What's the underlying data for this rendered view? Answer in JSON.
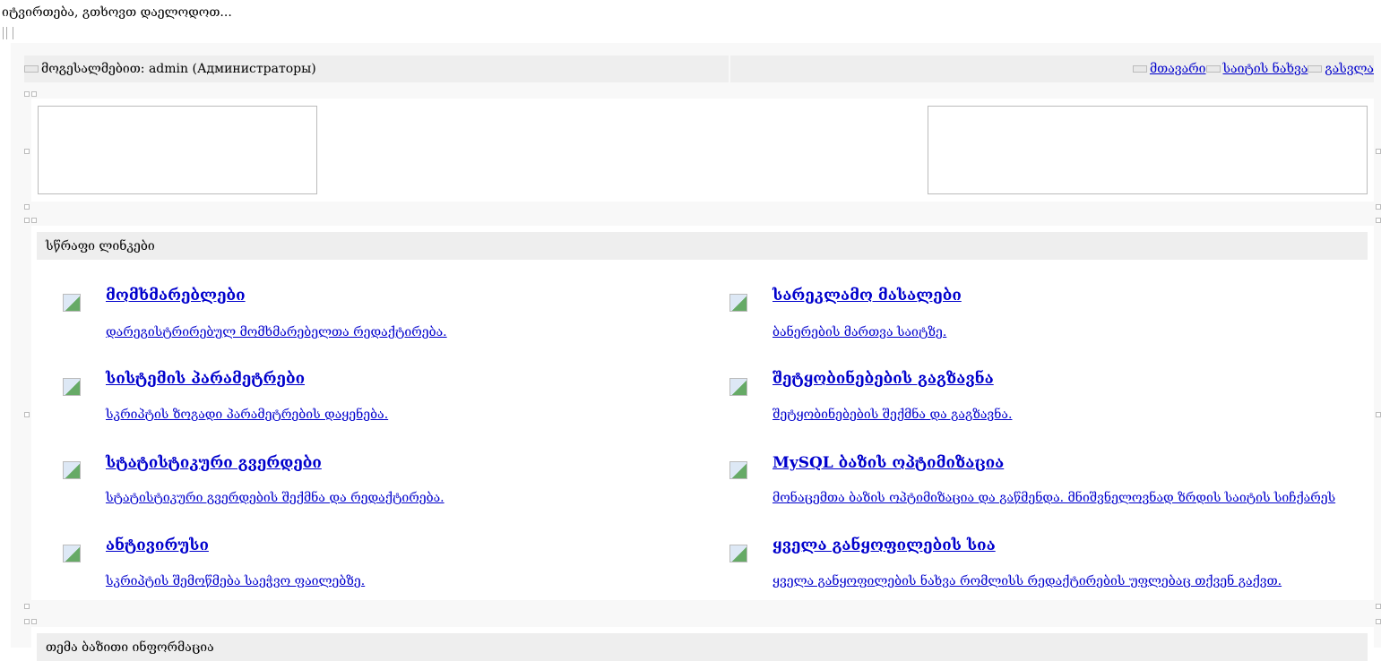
{
  "loading_text": "იტვირთება, გთხოვთ დაელოდოთ...",
  "header": {
    "greeting": "მოგესალმებით: admin (Администраторы)",
    "links": [
      "მთავარი",
      "საიტის ნახვა",
      "გასვლა"
    ]
  },
  "quick_links": {
    "title": "სწრაფი ლინკები",
    "items": [
      {
        "title": "მომხმარებლები",
        "desc": "დარეგისტრირებულ მომხმარებელთა რედაქტირება."
      },
      {
        "title": "სარეკლამო მასალები",
        "desc": "ბანერების მართვა საიტზე."
      },
      {
        "title": "სისტემის პარამეტრები",
        "desc": "სკრიპტის ზოგადი პარამეტრების დაყენება."
      },
      {
        "title": "შეტყობინებების გაგზავნა",
        "desc": "შეტყობინებების შექმნა და გაგზავნა."
      },
      {
        "title": "სტატისტიკური გვერდები",
        "desc": "სტატისტიკური გვერდების შექმნა და რედაქტირება."
      },
      {
        "title": "MySQL ბაზის ოპტიმიზაცია",
        "desc": "მონაცემთა ბაზის ოპტიმიზაცია და გაწმენდა. მნიშვნელოვნად ზრდის საიტის სიჩქარეს"
      },
      {
        "title": "ანტივირუსი",
        "desc": "სკრიპტის შემოწმება საეჭვო ფაილებზე."
      },
      {
        "title": "ყველა განყოფილების სია",
        "desc": "ყველა განყოფილების ნახვა რომლისს რედაქტირების უფლებაც თქვენ გაქვთ."
      }
    ]
  },
  "bottom_section": {
    "title": "თემა ბაზითი ინფორმაცია"
  }
}
